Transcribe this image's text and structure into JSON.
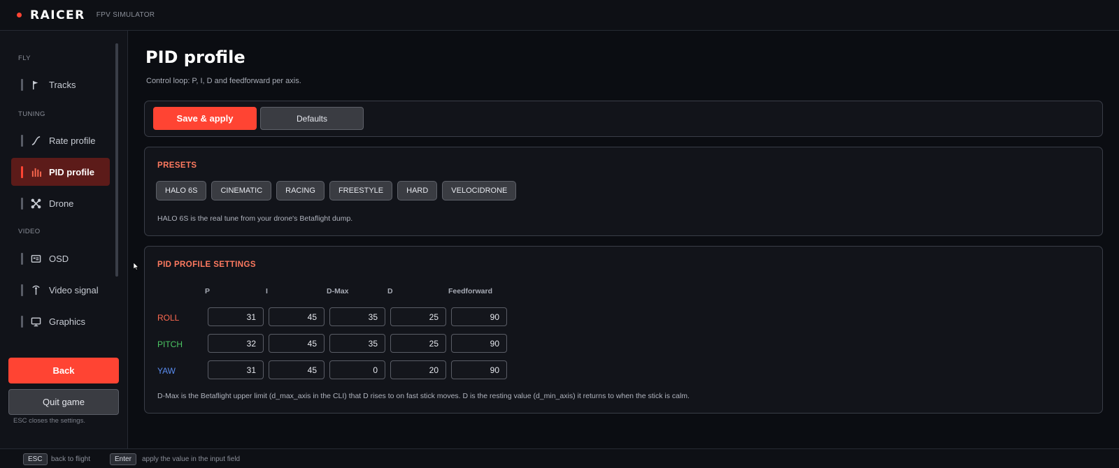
{
  "app": {
    "name": "RAICER",
    "subtitle": "FPV SIMULATOR"
  },
  "sidebar": {
    "sections": {
      "fly": "FLY",
      "tuning": "TUNING",
      "video": "VIDEO"
    },
    "items": [
      {
        "label": "Tracks",
        "icon": "flag-icon"
      },
      {
        "label": "Rate profile",
        "icon": "curve-icon"
      },
      {
        "label": "PID profile",
        "icon": "bars-icon",
        "active": true
      },
      {
        "label": "Drone",
        "icon": "drone-icon"
      },
      {
        "label": "OSD",
        "icon": "osd-icon"
      },
      {
        "label": "Video signal",
        "icon": "antenna-icon"
      },
      {
        "label": "Graphics",
        "icon": "monitor-icon"
      }
    ],
    "back_label": "Back",
    "quit_label": "Quit game",
    "esc_note": "ESC closes the settings."
  },
  "page": {
    "title": "PID profile",
    "subtitle": "Control loop: P, I, D and feedforward per axis."
  },
  "toolbar": {
    "save_label": "Save & apply",
    "defaults_label": "Defaults"
  },
  "presets": {
    "heading": "PRESETS",
    "items": [
      "HALO 6S",
      "CINEMATIC",
      "RACING",
      "FREESTYLE",
      "HARD",
      "VELOCIDRONE"
    ],
    "note": "HALO 6S is the real tune from your drone's Betaflight dump."
  },
  "pid": {
    "heading": "PID PROFILE SETTINGS",
    "columns": [
      "P",
      "I",
      "D-Max",
      "D",
      "Feedforward"
    ],
    "rows": [
      {
        "axis": "ROLL",
        "color": "#ff6a50",
        "values": [
          "31",
          "45",
          "35",
          "25",
          "90"
        ]
      },
      {
        "axis": "PITCH",
        "color": "#4cc864",
        "values": [
          "32",
          "45",
          "35",
          "25",
          "90"
        ]
      },
      {
        "axis": "YAW",
        "color": "#5a8cf0",
        "values": [
          "31",
          "45",
          "0",
          "20",
          "90"
        ]
      }
    ],
    "note": "D-Max is the Betaflight upper limit (d_max_axis in the CLI) that D rises to on fast stick moves. D is the resting value (d_min_axis) it returns to when the stick is calm."
  },
  "footer": {
    "esc_key": "ESC",
    "esc_hint": "back to flight",
    "enter_key": "Enter",
    "enter_hint": "apply the value in the input field"
  },
  "colors": {
    "accent": "#ff4433",
    "active_nav_bg": "#5c1b19",
    "heading": "#ff7a60"
  }
}
